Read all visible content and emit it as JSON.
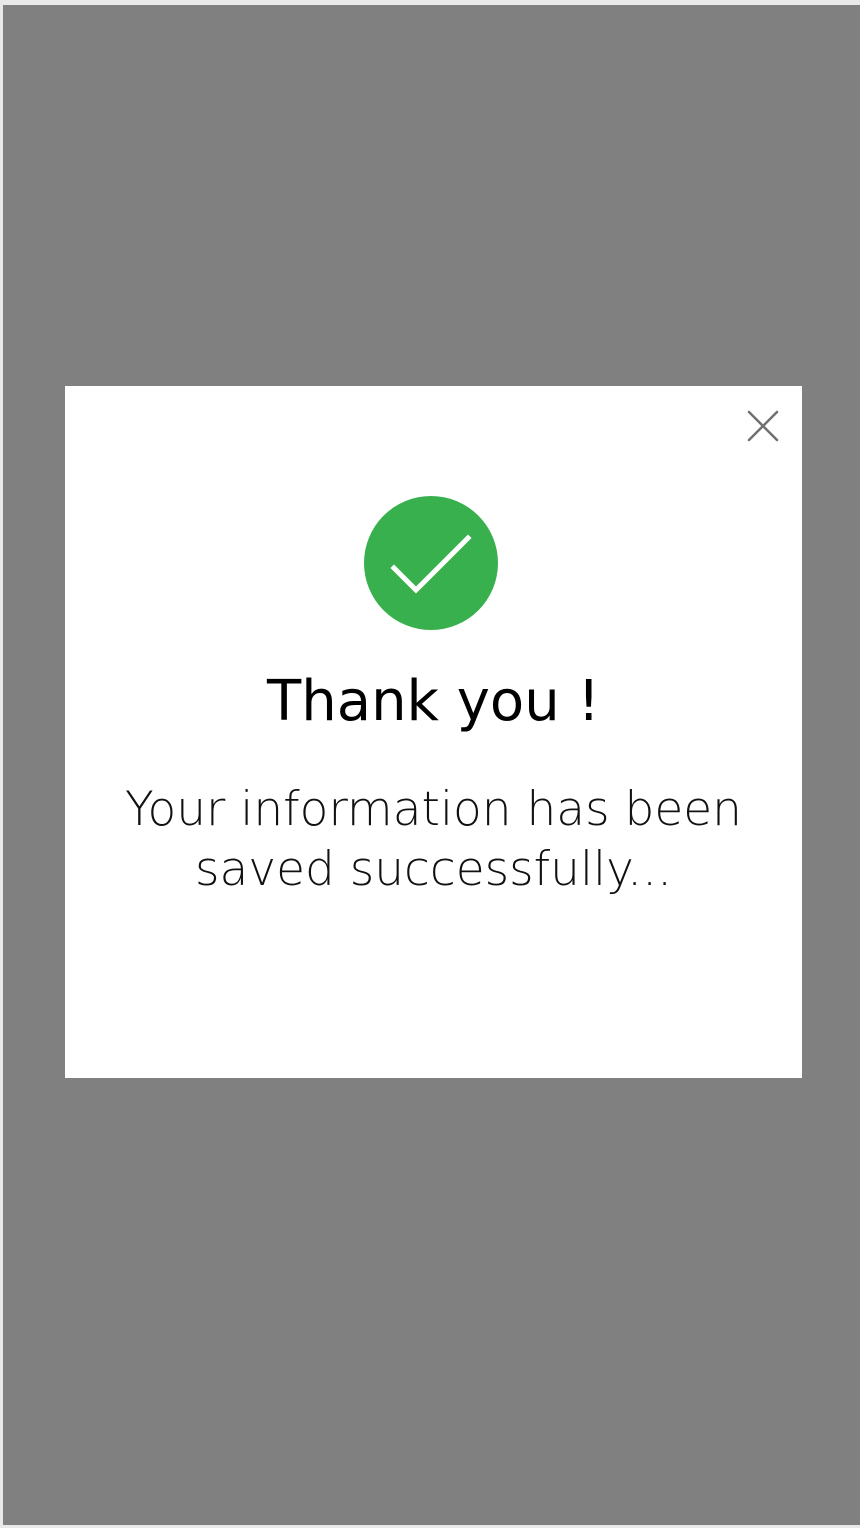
{
  "colors": {
    "backdrop": "#808080",
    "dialog_background": "#ffffff",
    "success": "#39b04e",
    "close_icon": "#707070"
  },
  "dialog": {
    "close_icon": "close-icon",
    "status_icon": "checkmark-icon",
    "title": "Thank you !",
    "message_line1": "Your information has been",
    "message_line2": "saved successfully..."
  }
}
